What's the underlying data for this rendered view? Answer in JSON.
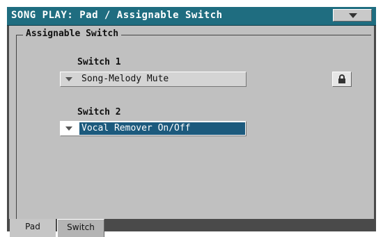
{
  "window": {
    "title": "SONG PLAY:  Pad / Assignable Switch"
  },
  "section": {
    "label": "Assignable Switch"
  },
  "switch1": {
    "label": "Switch 1",
    "value": "Song-Melody Mute",
    "locked": true
  },
  "switch2": {
    "label": "Switch 2",
    "value": "Vocal Remover On/Off",
    "selected": true
  },
  "tabs": [
    {
      "label": "Pad",
      "active": false
    },
    {
      "label": "Switch",
      "active": true
    }
  ],
  "colors": {
    "titlebar": "#1f6d80",
    "selection": "#1c5a7d",
    "panel": "#c0c0c0",
    "frame_dark": "#4a4a4a"
  },
  "icons": {
    "menu": "dropdown-triangle-icon",
    "lock": "lock-icon",
    "dropdown": "dropdown-arrow-icon"
  }
}
